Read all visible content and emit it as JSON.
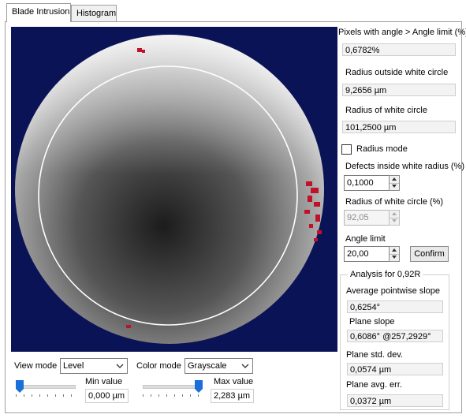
{
  "tabs": [
    {
      "label": "Blade Intrusion",
      "active": true
    },
    {
      "label": "Histogram",
      "active": false
    }
  ],
  "right": {
    "pixels_angle_label": "Pixels with angle > Angle limit (%)",
    "pixels_angle_value": "0,6782%",
    "radius_outside_label": "Radius outside white circle",
    "radius_outside_value": "9,2656 µm",
    "radius_white_label": "Radius of white circle",
    "radius_white_value": "101,2500 µm",
    "radius_mode_label": "Radius mode",
    "radius_mode_checked": false,
    "defects_label": "Defects inside white radius (%)",
    "defects_value": "0,1000",
    "radius_white_pct_label": "Radius of white circle (%)",
    "radius_white_pct_value": "92,05",
    "angle_limit_label": "Angle limit",
    "angle_limit_value": "20,00",
    "confirm_label": "Confirm"
  },
  "analysis": {
    "title": "Analysis for 0,92R",
    "avg_slope_label": "Average pointwise slope",
    "avg_slope_value": "0,6254°",
    "plane_slope_label": "Plane slope",
    "plane_slope_value": "0,6086° @257,2929°",
    "plane_std_label": "Plane std. dev.",
    "plane_std_value": "0,0574 µm",
    "plane_avg_label": "Plane avg. err.",
    "plane_avg_value": "0,0372 µm"
  },
  "bottom": {
    "view_mode_label": "View mode",
    "view_mode_value": "Level",
    "color_mode_label": "Color mode",
    "color_mode_value": "Grayscale",
    "min_label": "Min value",
    "min_value": "0,000 µm",
    "max_label": "Max value",
    "max_value": "2,283 µm",
    "min_slider_level": 0.0,
    "max_slider_level": 1.0
  },
  "colors": {
    "background": "#0b1357",
    "defect": "#c0102a",
    "circle": "#ffffff",
    "slider_thumb": "#1a6fd8"
  }
}
